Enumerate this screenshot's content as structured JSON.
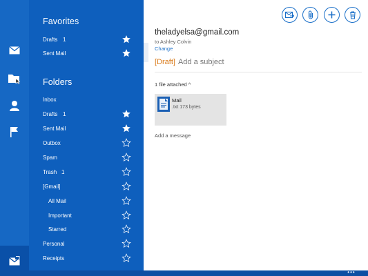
{
  "favorites": {
    "title": "Favorites",
    "items": [
      {
        "label": "Drafts",
        "count": "1",
        "starred": true
      },
      {
        "label": "Sent Mail",
        "count": "",
        "starred": true
      }
    ]
  },
  "folders": {
    "title": "Folders",
    "items": [
      {
        "label": "Inbox",
        "count": "",
        "starred": null
      },
      {
        "label": "Drafts",
        "count": "1",
        "starred": true
      },
      {
        "label": "Sent Mail",
        "count": "",
        "starred": true
      },
      {
        "label": "Outbox",
        "count": "",
        "starred": false
      },
      {
        "label": "Spam",
        "count": "",
        "starred": false
      },
      {
        "label": "Trash",
        "count": "1",
        "starred": false
      },
      {
        "label": "[Gmail]",
        "count": "",
        "starred": false
      },
      {
        "label": "All Mail",
        "count": "",
        "starred": false
      },
      {
        "label": "Important",
        "count": "",
        "starred": false
      },
      {
        "label": "Starred",
        "count": "",
        "starred": false
      },
      {
        "label": "Personal",
        "count": "",
        "starred": false
      },
      {
        "label": "Receipts",
        "count": "",
        "starred": false
      }
    ]
  },
  "rail_icons": [
    "mail-icon",
    "folder-icon",
    "people-icon",
    "flag-icon"
  ],
  "compose": {
    "toolbar_icons": [
      "send-icon",
      "attach-icon",
      "add-icon",
      "delete-icon"
    ],
    "to_address": "theladyelsa@gmail.com",
    "to_name": "to Ashley Colvin",
    "change_label": "Change",
    "draft_tag": "[Draft]",
    "subject_placeholder": "Add a subject",
    "attachments_label": "1 file attached ^",
    "attachment": {
      "name": "Mail",
      "meta": ".txt 173 bytes"
    },
    "message_placeholder": "Add a message"
  },
  "bottom_dots": "•••",
  "colors": {
    "rail": "#1668c4",
    "folder_pane": "#0e5fbd",
    "accent": "#1a6fc8",
    "draft": "#d97a1a"
  }
}
